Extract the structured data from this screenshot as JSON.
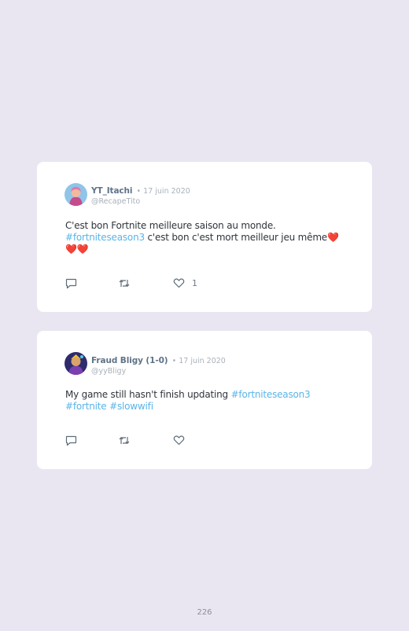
{
  "tweets": [
    {
      "name": "YT_Itachi",
      "date": "• 17 juin 2020",
      "handle": "@RecapeTito",
      "text_line1": "C'est bon Fortnite meilleure saison au monde.",
      "hashtag1": "#fortniteseason3",
      "text_line2": " c'est bon c'est mort meilleur jeu même",
      "emoji": "❤️❤️❤️",
      "like_count": "1"
    },
    {
      "name": "Fraud Bligy (1-0)",
      "date": "• 17 juin 2020",
      "handle": "@yyBligy",
      "text": "My game still hasn't finish updating ",
      "hashtag1": "#fortniteseason3",
      "hashtag2": "#fortnite",
      "hashtag3": "#slowwifi"
    }
  ],
  "icons": {
    "reply": "reply-icon",
    "retweet": "retweet-icon",
    "like": "heart-icon"
  },
  "colors": {
    "background": "#e9e6f1",
    "card": "#ffffff",
    "hashtag": "#5ab4e8",
    "name": "#5f7388"
  },
  "page_number": "226"
}
